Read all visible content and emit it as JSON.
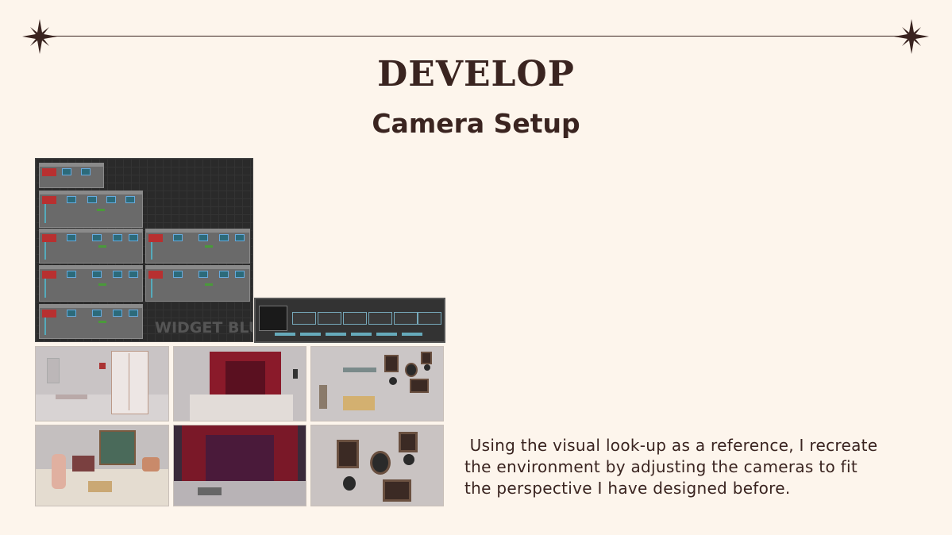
{
  "header": {
    "title": "DEVELOP",
    "subtitle": "Camera Setup"
  },
  "images": {
    "blueprint_watermark": "WIDGET BLU"
  },
  "body": {
    "line1": " Using the visual look-up as a reference, I recreate",
    "line2": "the environment by adjusting the cameras to fit",
    "line3": "the perspective I have designed before."
  },
  "colors": {
    "background": "#fdf5ec",
    "text": "#3a2420"
  },
  "icons": {
    "left_ornament": "four-point-star-icon",
    "right_ornament": "four-point-star-icon"
  }
}
